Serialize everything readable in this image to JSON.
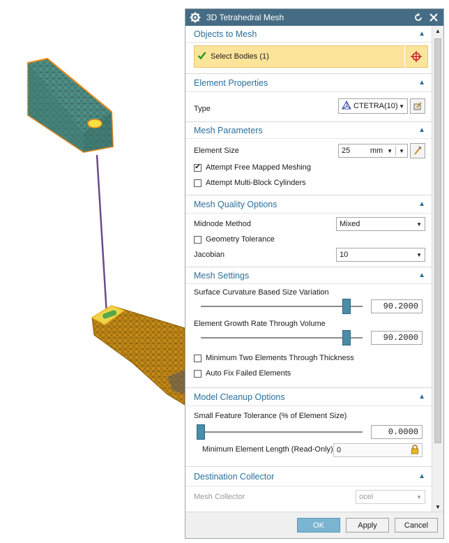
{
  "dialog": {
    "title": "3D Tetrahedral Mesh"
  },
  "objects": {
    "title": "Objects to Mesh",
    "select_label": "Select Bodies (1)"
  },
  "element_properties": {
    "title": "Element Properties",
    "type_label": "Type",
    "type_value": "CTETRA(10)"
  },
  "mesh_parameters": {
    "title": "Mesh Parameters",
    "element_size_label": "Element Size",
    "element_size_value": "25",
    "element_size_unit": "mm",
    "free_mapped_label": "Attempt Free Mapped Meshing",
    "free_mapped_checked": true,
    "multiblock_label": "Attempt Multi-Block Cylinders",
    "multiblock_checked": false
  },
  "quality": {
    "title": "Mesh Quality Options",
    "midnode_label": "Midnode Method",
    "midnode_value": "Mixed",
    "geom_tol_label": "Geometry Tolerance",
    "jacobian_label": "Jacobian",
    "jacobian_value": "10"
  },
  "settings": {
    "title": "Mesh Settings",
    "curvature_label": "Surface Curvature Based Size Variation",
    "curvature_value": "90.2000",
    "curvature_level": 0.902,
    "growth_label": "Element Growth Rate Through Volume",
    "growth_value": "90.2000",
    "growth_level": 0.902,
    "min_two_label": "Minimum Two Elements Through Thickness",
    "autofix_label": "Auto Fix Failed Elements"
  },
  "cleanup": {
    "title": "Model Cleanup Options",
    "small_feature_label": "Small Feature Tolerance (% of Element Size)",
    "small_feature_value": "0.0000",
    "small_feature_level": 0.0,
    "min_len_label": "Minimum Element Length (Read-Only)",
    "min_len_value": "0"
  },
  "destination": {
    "title": "Destination Collector",
    "collector_label": "Mesh Collector",
    "collector_value": "ocel"
  },
  "buttons": {
    "ok": "OK",
    "apply": "Apply",
    "cancel": "Cancel"
  },
  "colors": {
    "title_bar": "#456c84",
    "group_title": "#2b6f9a",
    "selection": "#fde49b",
    "mesh_green": "#4f8f86",
    "mesh_orange": "#c48a19"
  },
  "icons": {
    "dialog": "gear-icon",
    "reset": "reset-icon",
    "close": "close-icon",
    "select": "crosshair-icon",
    "check": "check-icon"
  }
}
